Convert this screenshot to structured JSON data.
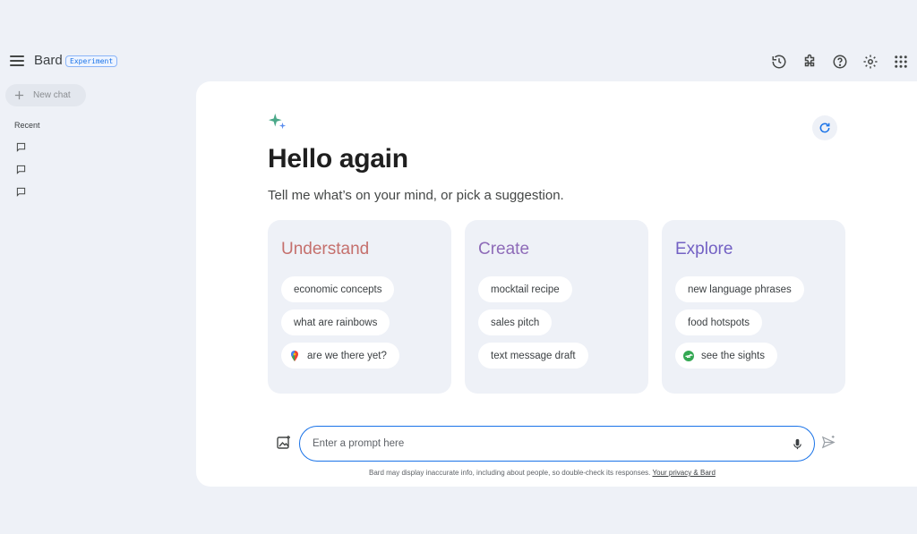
{
  "header": {
    "brand": "Bard",
    "badge": "Experiment",
    "actions": [
      "history-icon",
      "extensions-icon",
      "help-icon",
      "settings-icon",
      "apps-grid-icon"
    ]
  },
  "sidebar": {
    "new_chat_label": "New chat",
    "recent_label": "Recent",
    "recent_items": [
      "",
      "",
      ""
    ]
  },
  "main": {
    "greeting": "Hello again",
    "subtitle": "Tell me what’s on your mind, or pick a suggestion.",
    "cards": [
      {
        "title": "Understand",
        "chips": [
          {
            "label": "economic concepts"
          },
          {
            "label": "what are rainbows"
          },
          {
            "label": "are we there yet?",
            "icon": "maps-pin-icon"
          }
        ]
      },
      {
        "title": "Create",
        "chips": [
          {
            "label": "mocktail recipe"
          },
          {
            "label": "sales pitch"
          },
          {
            "label": "text message draft"
          }
        ]
      },
      {
        "title": "Explore",
        "chips": [
          {
            "label": "new language phrases"
          },
          {
            "label": "food hotspots"
          },
          {
            "label": "see the sights",
            "icon": "flights-icon"
          }
        ]
      }
    ],
    "prompt_placeholder": "Enter a prompt here",
    "disclaimer": "Bard may display inaccurate info, including about people, so double-check its responses.",
    "privacy_link": "Your privacy & Bard"
  },
  "colors": {
    "background": "#eef1f7",
    "accent": "#1a73e8",
    "understand": "#c5706d",
    "create": "#8e6bb8",
    "explore": "#7361c4"
  }
}
